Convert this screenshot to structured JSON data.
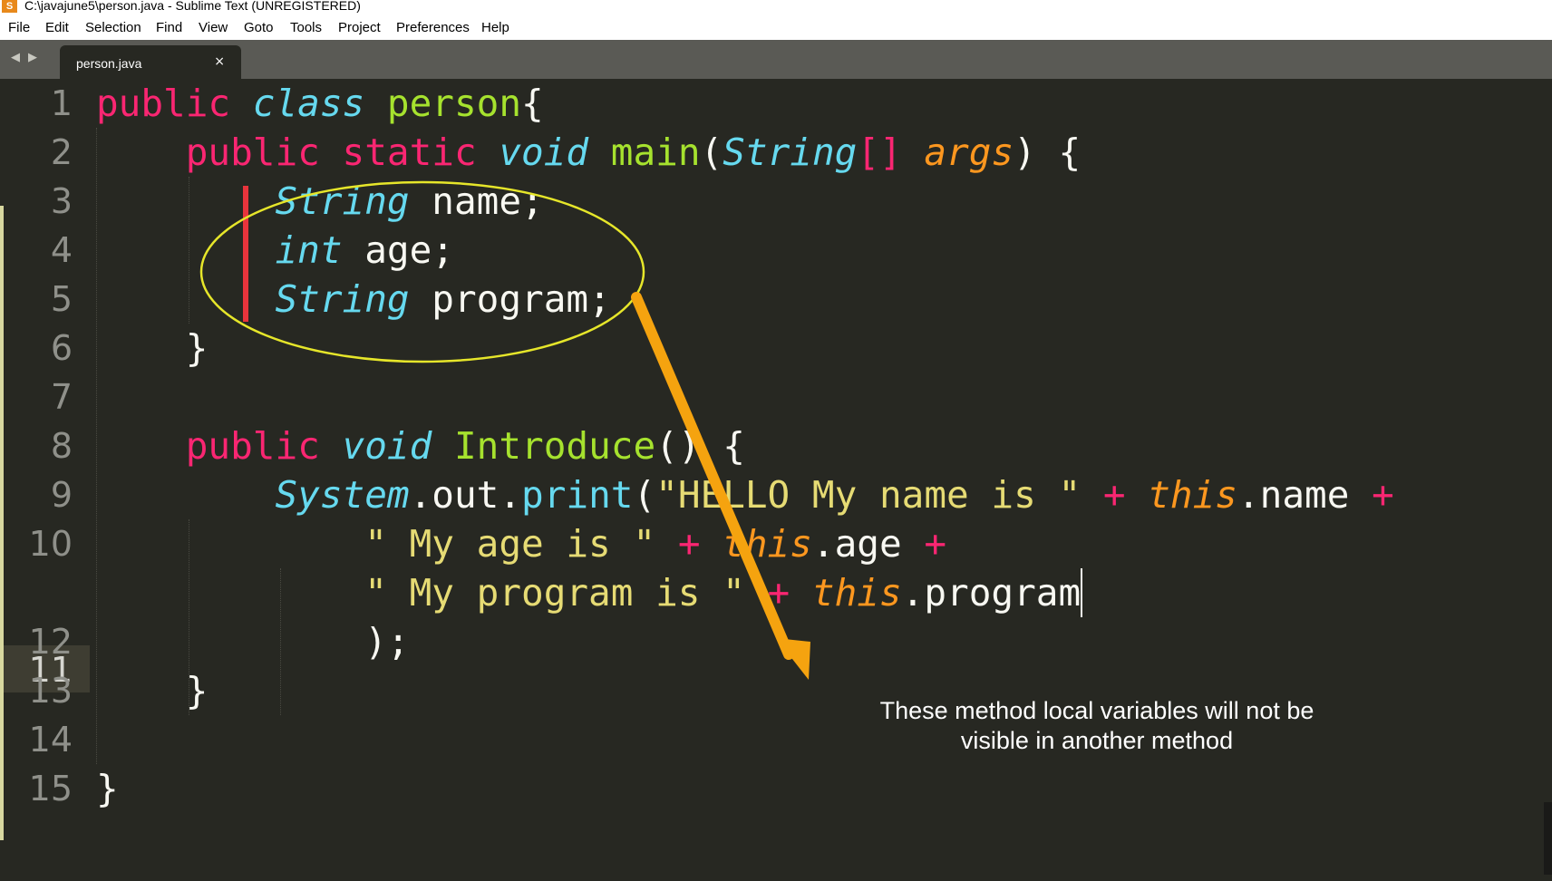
{
  "window": {
    "title": "C:\\javajune5\\person.java - Sublime Text (UNREGISTERED)"
  },
  "menu": [
    "File",
    "Edit",
    "Selection",
    "Find",
    "View",
    "Goto",
    "Tools",
    "Project",
    "Preferences",
    "Help"
  ],
  "tabs": [
    {
      "label": "person.java",
      "close": "×"
    }
  ],
  "nav": {
    "back": "◀",
    "forward": "▶"
  },
  "editor": {
    "line_numbers": [
      "1",
      "2",
      "3",
      "4",
      "5",
      "6",
      "7",
      "8",
      "9",
      "10",
      "11",
      "12",
      "13",
      "14",
      "15"
    ],
    "active_line": "11",
    "code": {
      "l1": {
        "kw": "public",
        "cls": "class",
        "name": "person",
        "brace": "{"
      },
      "l2": {
        "kw1": "public",
        "kw2": "static",
        "type": "void",
        "fn": "main",
        "open": "(",
        "ptype": "String",
        "br": "[]",
        "arg": "args",
        "close": ")",
        "brace": "{"
      },
      "l3": {
        "type": "String",
        "var": "name;"
      },
      "l4": {
        "type": "int",
        "var": "age;"
      },
      "l5": {
        "type": "String",
        "var": "program;"
      },
      "l6": {
        "brace": "}"
      },
      "l8": {
        "kw": "public",
        "type": "void",
        "fn": "Introduce",
        "parens": "()",
        "brace": "{"
      },
      "l9": {
        "sys": "System",
        "dot1": ".",
        "out": "out",
        "dot2": ".",
        "fn": "print",
        "open": "(",
        "str": "\"HELLO My name is \"",
        "plus1": "+",
        "this": "this",
        "field": ".name",
        "plus2": "+"
      },
      "l10": {
        "str": "\" My age is \"",
        "plus1": "+",
        "this": "this",
        "field": ".age",
        "plus2": "+"
      },
      "l11": {
        "str": "\" My program is \"",
        "plus1": "+",
        "this": "this",
        "field": ".program"
      },
      "l12": {
        "end": ");"
      },
      "l13": {
        "brace": "}"
      },
      "l15": {
        "brace": "}"
      }
    }
  },
  "annotation": {
    "line1": "These method local variables will not be",
    "line2": "visible in another method",
    "ellipse_color": "#e6e62a",
    "arrow_color": "#f5a30f",
    "marker_color": "#e8343c"
  }
}
